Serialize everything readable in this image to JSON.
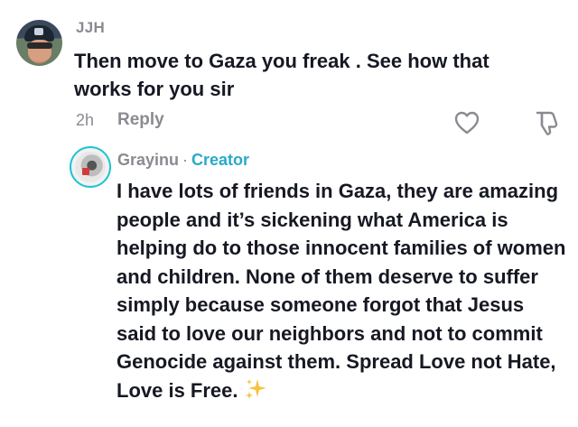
{
  "comment": {
    "username": "JJH",
    "text": "Then move to Gaza you freak . See how that works for you sir",
    "time": "2h",
    "reply_label": "Reply",
    "like_icon": "heart-outline-icon",
    "dislike_icon": "thumbs-down-outline-icon"
  },
  "reply": {
    "username": "Grayinu",
    "separator": "·",
    "badge": "Creator",
    "badge_color": "#2aa9c9",
    "text": "I have lots of friends in Gaza, they are amazing people and it’s sickening what America is helping do to those innocent families of women and children. None of them deserve to suffer simply because someone forgot that Jesus said to love our neighbors and not to commit Genocide against them. Spread Love not Hate, Love is Free.",
    "emoji_icon": "sparkles-icon"
  }
}
